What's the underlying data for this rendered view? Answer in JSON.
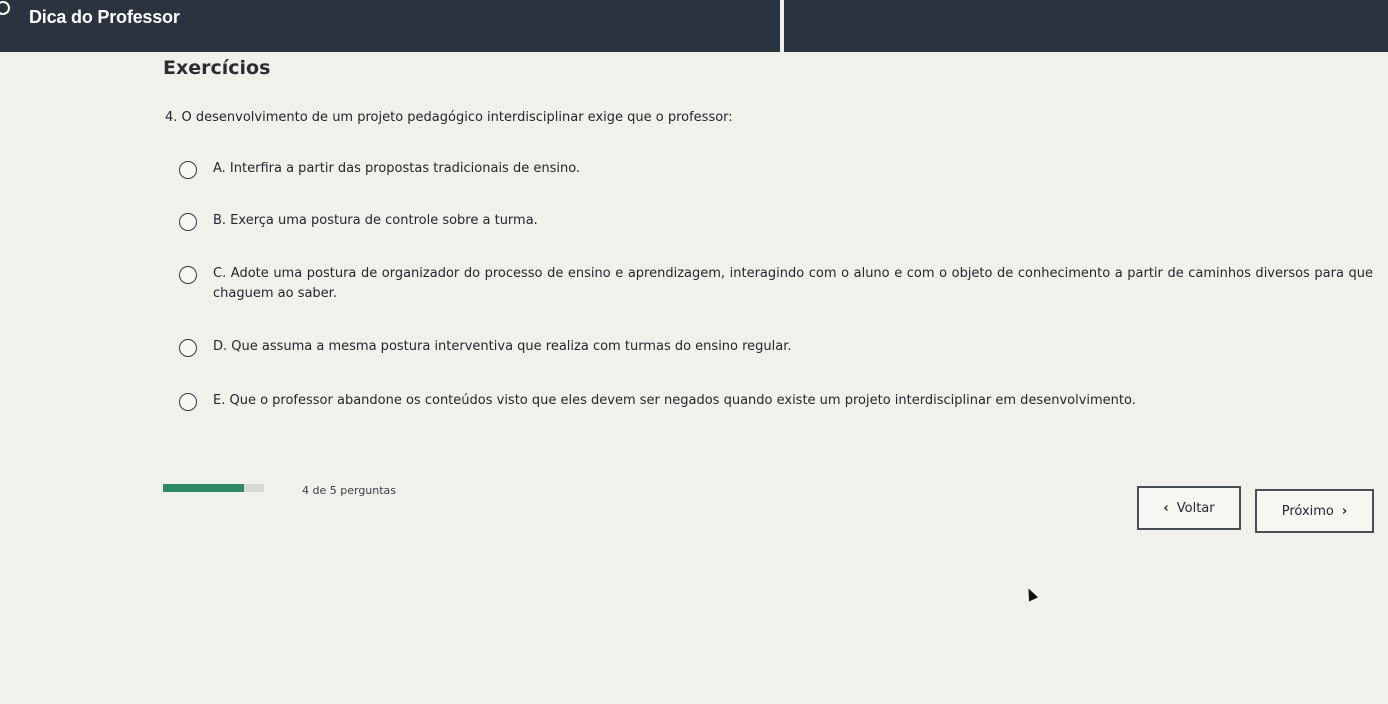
{
  "header": {
    "title": "Dica do Professor"
  },
  "main": {
    "section_title": "Exercícios",
    "question": "4. O desenvolvimento de um projeto pedagógico interdisciplinar exige que o professor:",
    "options": [
      {
        "label": "A. Interfira a partir das propostas tradicionais de ensino."
      },
      {
        "label": "B. Exerça uma postura de controle sobre a turma."
      },
      {
        "label": "C. Adote uma postura de organizador do processo de ensino e aprendizagem, interagindo com o aluno e com o objeto de conhecimento a partir de caminhos diversos para que chaguem ao saber."
      },
      {
        "label": "D. Que assuma a mesma postura interventiva que realiza com turmas do ensino regular."
      },
      {
        "label": "E. Que o professor abandone os conteúdos visto que eles devem ser negados quando existe um projeto interdisciplinar em desenvolvimento."
      }
    ]
  },
  "footer": {
    "progress_label": "4 de 5 perguntas",
    "progress_fraction": 0.8,
    "progress_color": "#2e8a66",
    "back_label": "Voltar",
    "next_label": "Próximo",
    "back_icon": "chevron-left-icon",
    "next_icon": "chevron-right-icon"
  },
  "colors": {
    "header_bg": "#2b3340",
    "page_bg": "#f1f1ec"
  }
}
